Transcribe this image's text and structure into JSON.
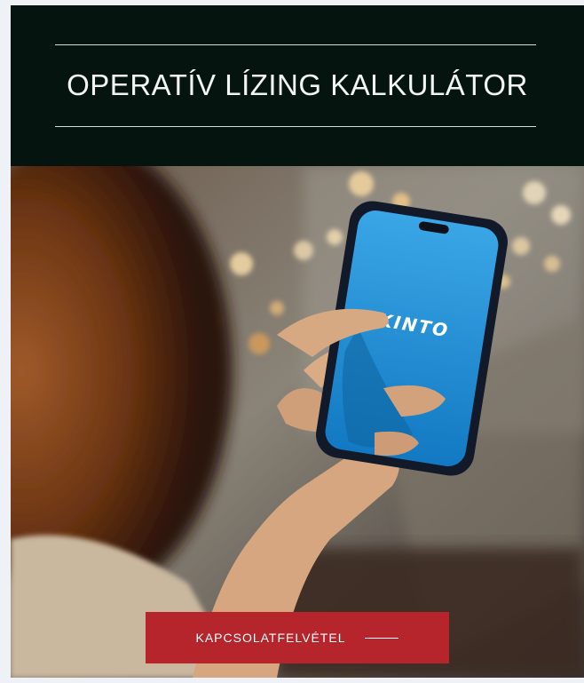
{
  "header": {
    "title": "OPERATÍV LÍZING KALKULÁTOR"
  },
  "hero": {
    "phone_brand": "KINTO",
    "image_name": "hand-holding-phone-photo"
  },
  "cta": {
    "label": "KAPCSOLATFELVÉTEL"
  },
  "colors": {
    "header_bg": "#05140f",
    "accent": "#b5252b",
    "phone_screen": "#1e8fd6"
  }
}
